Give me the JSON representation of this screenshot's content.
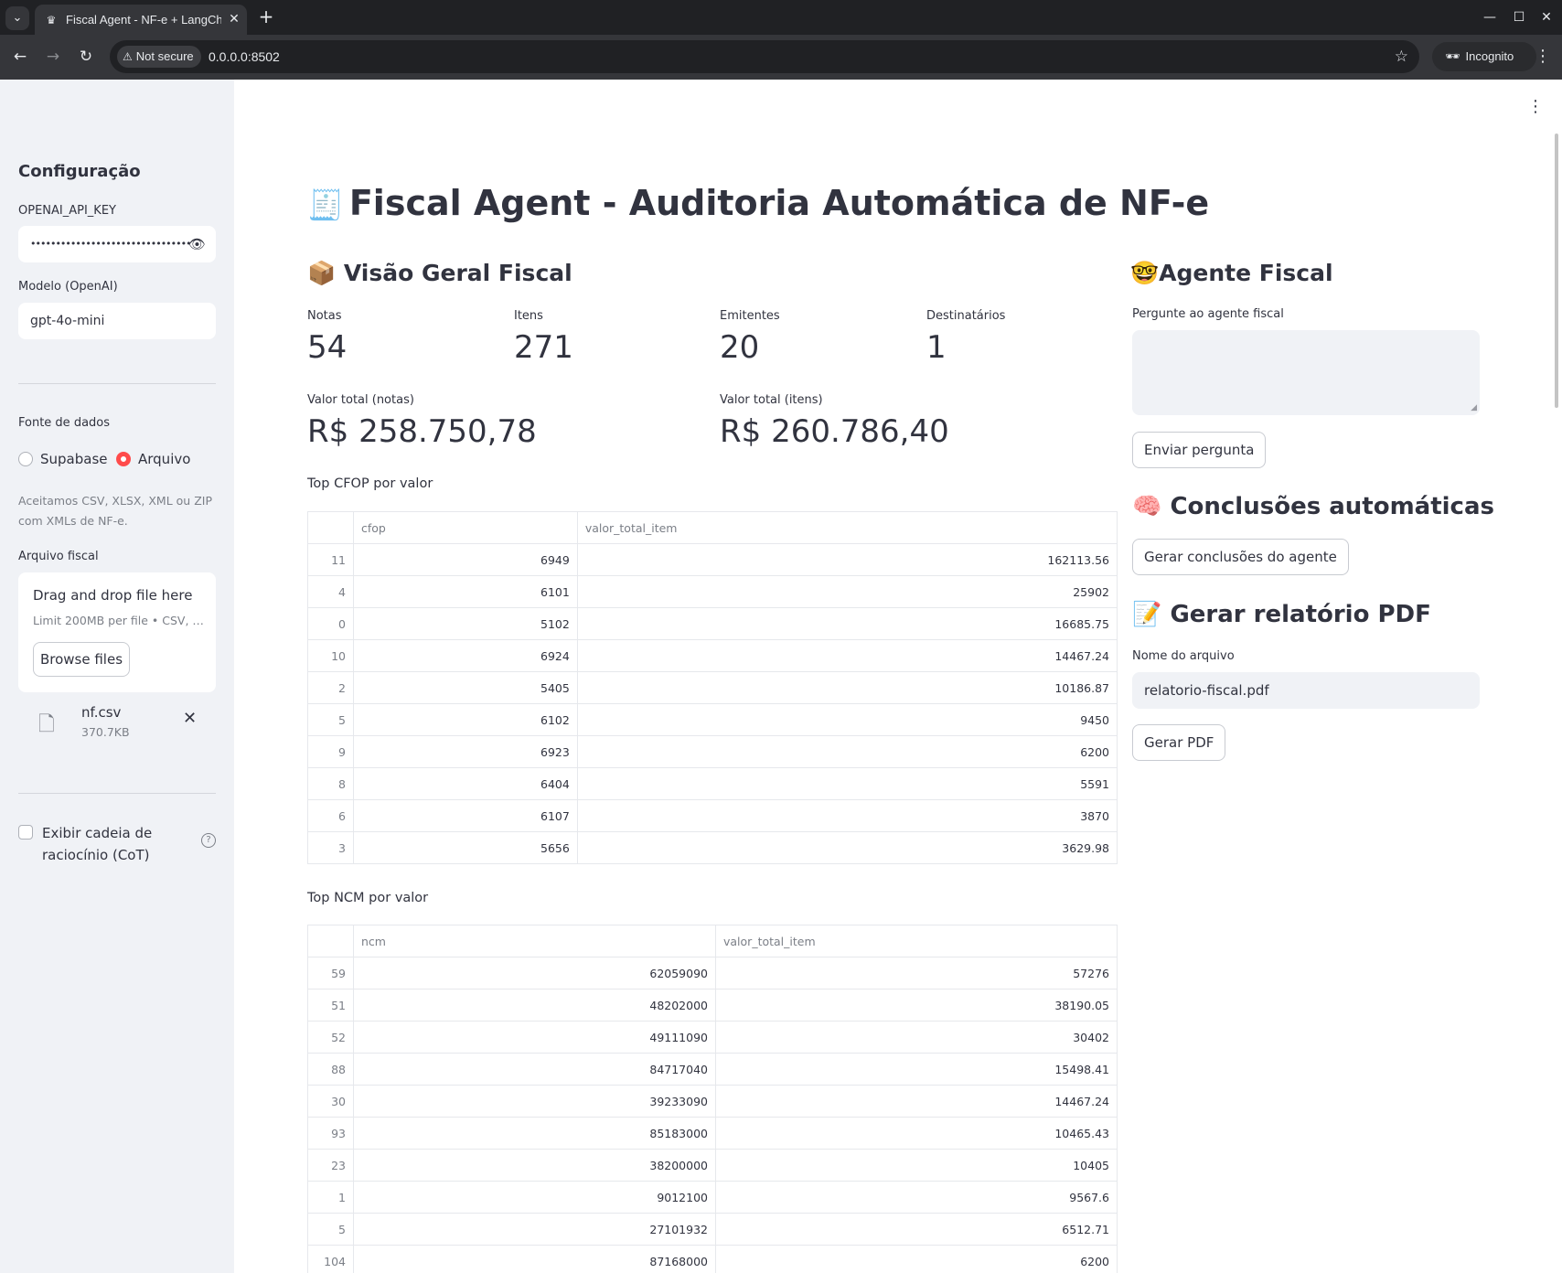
{
  "browser": {
    "tab_title": "Fiscal Agent - NF-e + LangChain",
    "security_label": "Not secure",
    "url": "0.0.0.0:8502",
    "incognito_label": "Incognito"
  },
  "sidebar": {
    "title": "Configuração",
    "api_key_label": "OPENAI_API_KEY",
    "api_key_value": "••••••••••••••••••••••••••••••••",
    "model_label": "Modelo (OpenAI)",
    "model_value": "gpt-4o-mini",
    "source_label": "Fonte de dados",
    "source_options": [
      "Supabase",
      "Arquivo"
    ],
    "source_selected": "Arquivo",
    "help_text": "Aceitamos CSV, XLSX, XML ou ZIP com XMLs de NF-e.",
    "file_label": "Arquivo fiscal",
    "dropzone_title": "Drag and drop file here",
    "dropzone_limit": "Limit 200MB per file • CSV, XLSX, XML, ZIP",
    "browse_label": "Browse files",
    "uploaded_file": {
      "name": "nf.csv",
      "size": "370.7KB"
    },
    "cot_label": "Exibir cadeia de raciocínio (CoT)",
    "help_icon": "?"
  },
  "main": {
    "title": "Fiscal Agent - Auditoria Automática de NF-e",
    "title_emoji": "🧾",
    "overview_heading": "Visão Geral Fiscal",
    "overview_emoji": "📦",
    "metrics": [
      {
        "label": "Notas",
        "value": "54"
      },
      {
        "label": "Itens",
        "value": "271"
      },
      {
        "label": "Emitentes",
        "value": "20"
      },
      {
        "label": "Destinatários",
        "value": "1"
      }
    ],
    "totals": [
      {
        "label": "Valor total (notas)",
        "value": "R$ 258.750,78"
      },
      {
        "label": "Valor total (itens)",
        "value": "R$ 260.786,40"
      }
    ],
    "cfop_caption": "Top CFOP por valor",
    "cfop_table": {
      "columns": [
        "cfop",
        "valor_total_item"
      ],
      "rows": [
        {
          "index": "11",
          "key": "6949",
          "value": "162113.56"
        },
        {
          "index": "4",
          "key": "6101",
          "value": "25902"
        },
        {
          "index": "0",
          "key": "5102",
          "value": "16685.75"
        },
        {
          "index": "10",
          "key": "6924",
          "value": "14467.24"
        },
        {
          "index": "2",
          "key": "5405",
          "value": "10186.87"
        },
        {
          "index": "5",
          "key": "6102",
          "value": "9450"
        },
        {
          "index": "9",
          "key": "6923",
          "value": "6200"
        },
        {
          "index": "8",
          "key": "6404",
          "value": "5591"
        },
        {
          "index": "6",
          "key": "6107",
          "value": "3870"
        },
        {
          "index": "3",
          "key": "5656",
          "value": "3629.98"
        }
      ]
    },
    "ncm_caption": "Top NCM por valor",
    "ncm_table": {
      "columns": [
        "ncm",
        "valor_total_item"
      ],
      "rows": [
        {
          "index": "59",
          "key": "62059090",
          "value": "57276"
        },
        {
          "index": "51",
          "key": "48202000",
          "value": "38190.05"
        },
        {
          "index": "52",
          "key": "49111090",
          "value": "30402"
        },
        {
          "index": "88",
          "key": "84717040",
          "value": "15498.41"
        },
        {
          "index": "30",
          "key": "39233090",
          "value": "14467.24"
        },
        {
          "index": "93",
          "key": "85183000",
          "value": "10465.43"
        },
        {
          "index": "23",
          "key": "38200000",
          "value": "10405"
        },
        {
          "index": "1",
          "key": "9012100",
          "value": "9567.6"
        },
        {
          "index": "5",
          "key": "27101932",
          "value": "6512.71"
        },
        {
          "index": "104",
          "key": "87168000",
          "value": "6200"
        }
      ]
    }
  },
  "agent": {
    "heading": "Agente Fiscal",
    "heading_emoji": "🤓",
    "question_label": "Pergunte ao agente fiscal",
    "question_value": "",
    "send_label": "Enviar pergunta",
    "conclusions_heading": "Conclusões automáticas",
    "conclusions_emoji": "🧠",
    "conclusions_button": "Gerar conclusões do agente",
    "pdf_heading": "Gerar relatório PDF",
    "pdf_emoji": "📝",
    "filename_label": "Nome do arquivo",
    "filename_value": "relatorio-fiscal.pdf",
    "pdf_button": "Gerar PDF"
  },
  "colors": {
    "accent": "#ff4b4b",
    "sidebar_bg": "#f0f2f6",
    "text": "#31333f"
  }
}
